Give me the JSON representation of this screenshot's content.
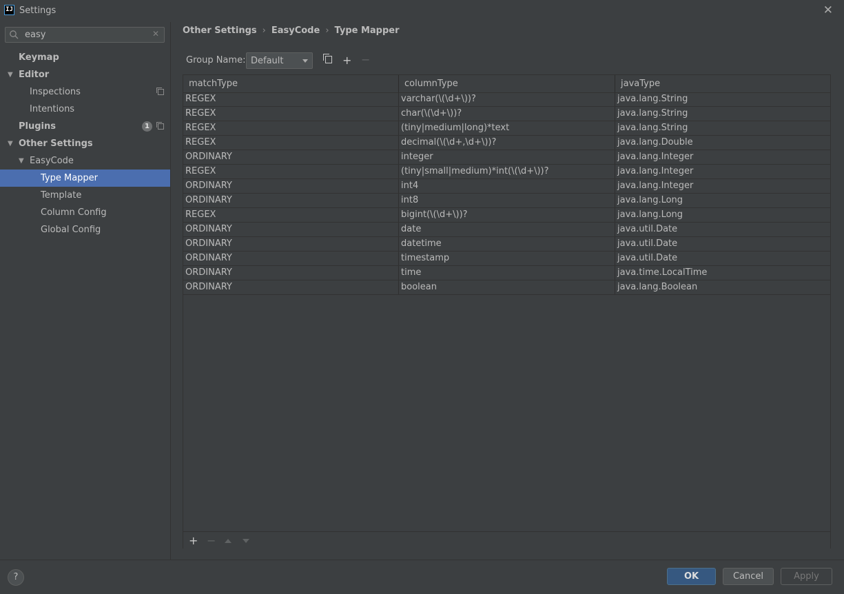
{
  "window": {
    "title": "Settings",
    "app_icon_text": "IJ"
  },
  "search": {
    "value": "easy"
  },
  "sidebar": {
    "items": [
      {
        "label": "Keymap"
      },
      {
        "label": "Editor"
      },
      {
        "label": "Inspections"
      },
      {
        "label": "Intentions"
      },
      {
        "label": "Plugins",
        "badge": "1"
      },
      {
        "label": "Other Settings"
      },
      {
        "label": "EasyCode"
      },
      {
        "label": "Type Mapper"
      },
      {
        "label": "Template"
      },
      {
        "label": "Column Config"
      },
      {
        "label": "Global Config"
      }
    ]
  },
  "breadcrumb": {
    "items": [
      "Other Settings",
      "EasyCode",
      "Type Mapper"
    ]
  },
  "group": {
    "label": "Group Name:",
    "value": "Default"
  },
  "table": {
    "columns": [
      "matchType",
      "columnType",
      "javaType"
    ],
    "rows": [
      [
        "REGEX",
        "varchar(\\(\\d+\\))?",
        "java.lang.String"
      ],
      [
        "REGEX",
        "char(\\(\\d+\\))?",
        "java.lang.String"
      ],
      [
        "REGEX",
        "(tiny|medium|long)*text",
        "java.lang.String"
      ],
      [
        "REGEX",
        "decimal(\\(\\d+,\\d+\\))?",
        "java.lang.Double"
      ],
      [
        "ORDINARY",
        "integer",
        "java.lang.Integer"
      ],
      [
        "REGEX",
        "(tiny|small|medium)*int(\\(\\d+\\))?",
        "java.lang.Integer"
      ],
      [
        "ORDINARY",
        "int4",
        "java.lang.Integer"
      ],
      [
        "ORDINARY",
        "int8",
        "java.lang.Long"
      ],
      [
        "REGEX",
        "bigint(\\(\\d+\\))?",
        "java.lang.Long"
      ],
      [
        "ORDINARY",
        "date",
        "java.util.Date"
      ],
      [
        "ORDINARY",
        "datetime",
        "java.util.Date"
      ],
      [
        "ORDINARY",
        "timestamp",
        "java.util.Date"
      ],
      [
        "ORDINARY",
        "time",
        "java.time.LocalTime"
      ],
      [
        "ORDINARY",
        "boolean",
        "java.lang.Boolean"
      ]
    ]
  },
  "buttons": {
    "ok": "OK",
    "cancel": "Cancel",
    "apply": "Apply",
    "help": "?"
  },
  "colors": {
    "selection": "#4b6eaf",
    "background": "#3c3f41",
    "ok_button": "#365880"
  }
}
